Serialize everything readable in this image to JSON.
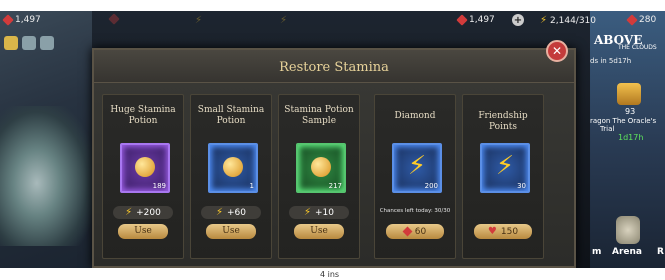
{
  "hud": {
    "gems": "1,497",
    "stamina": "2,144/310",
    "diamonds_right": "280"
  },
  "background_left": {
    "gems": "1,497"
  },
  "right_panel": {
    "title": "ABOVE",
    "subtitle": "THE CLOUDS",
    "event_time": "ds in 5d17h",
    "trophy_count": "93",
    "oracle_line1": "ragon The Oracle's",
    "oracle_line2": "Trial",
    "oracle_timer": "1d17h",
    "arena_label": "Arena",
    "m_label": "m",
    "r_label": "R"
  },
  "dialog": {
    "title": "Restore Stamina",
    "cards": [
      {
        "name": "Huge Stamina Potion",
        "qty": "189",
        "gain": "+200",
        "action": "Use",
        "frame": "purple"
      },
      {
        "name": "Small Stamina Potion",
        "qty": "1",
        "gain": "+60",
        "action": "Use",
        "frame": "blue"
      },
      {
        "name": "Stamina Potion Sample",
        "qty": "217",
        "gain": "+10",
        "action": "Use",
        "frame": "green"
      },
      {
        "name": "Diamond",
        "qty": "200",
        "chances": "Chances left today: 30/30",
        "price": "60",
        "frame": "blue"
      },
      {
        "name": "Friendship Points",
        "qty": "30",
        "price": "150",
        "frame": "blue"
      }
    ]
  },
  "bottom_text": "4 ins"
}
